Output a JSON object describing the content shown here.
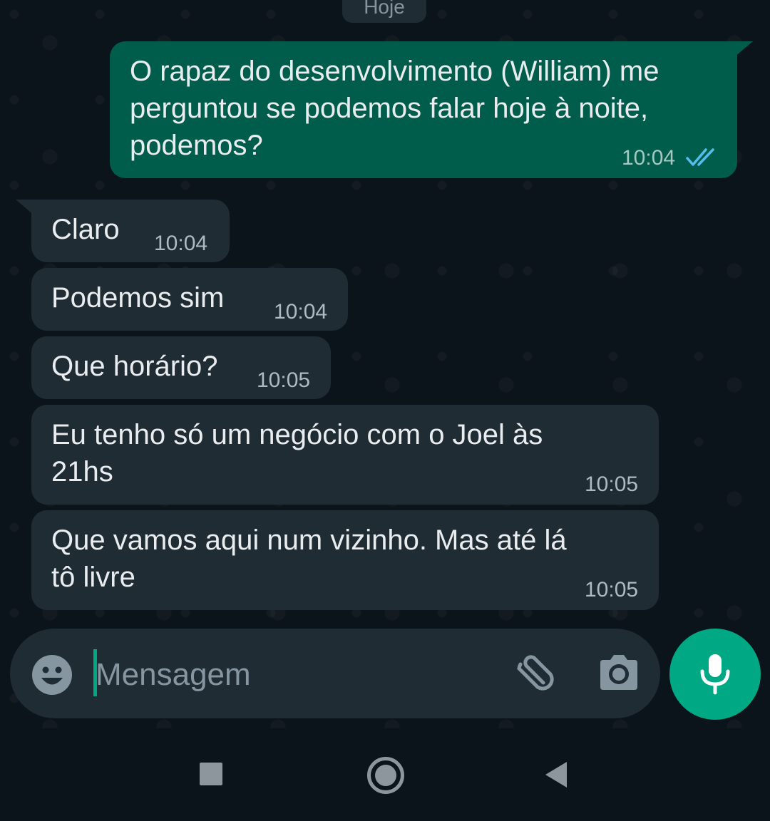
{
  "date_chip": "Hoje",
  "outgoing": {
    "lines": [
      "O rapaz do desenvolvimento (William) me",
      "perguntou se podemos falar hoje à noite,",
      "podemos?"
    ],
    "time": "10:04",
    "status": "read-double-check-icon"
  },
  "incoming": [
    {
      "lines": [
        "Claro"
      ],
      "time": "10:04"
    },
    {
      "lines": [
        "Podemos sim"
      ],
      "time": "10:04"
    },
    {
      "lines": [
        "Que horário?"
      ],
      "time": "10:05"
    },
    {
      "lines": [
        "Eu tenho só um negócio com o Joel às",
        "21hs"
      ],
      "time": "10:05"
    },
    {
      "lines": [
        "Que vamos aqui num vizinho. Mas até lá",
        "tô livre"
      ],
      "time": "10:05"
    }
  ],
  "composer": {
    "placeholder": "Mensagem",
    "emoji_icon": "emoji-icon",
    "attach_icon": "paperclip-icon",
    "camera_icon": "camera-icon",
    "mic_icon": "microphone-icon"
  },
  "nav": {
    "recent_icon": "square-icon",
    "home_icon": "circle-icon",
    "back_icon": "triangle-back-icon"
  },
  "colors": {
    "background": "#0b141a",
    "outgoing_bubble": "#005c4b",
    "incoming_bubble": "#202c33",
    "accent": "#00a884",
    "read_ticks": "#53bdeb"
  }
}
